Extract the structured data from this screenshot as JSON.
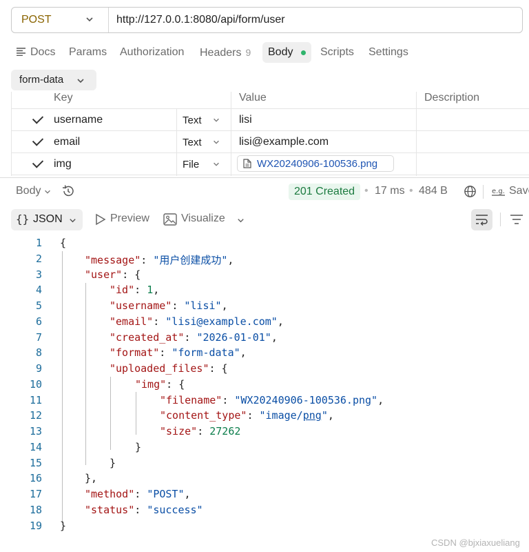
{
  "request": {
    "method": "POST",
    "url": "http://127.0.0.1:8080/api/form/user"
  },
  "tabs": {
    "docs": "Docs",
    "params": "Params",
    "authorization": "Authorization",
    "headers": "Headers",
    "headers_count": "9",
    "body": "Body",
    "scripts": "Scripts",
    "settings": "Settings"
  },
  "body_type": "form-data",
  "params_table": {
    "headers": [
      "Key",
      "Value",
      "Description"
    ],
    "rows": [
      {
        "key": "username",
        "type": "Text",
        "value": "lisi",
        "checked": true
      },
      {
        "key": "email",
        "type": "Text",
        "value": "lisi@example.com",
        "checked": true
      },
      {
        "key": "img",
        "type": "File",
        "value": "WX20240906-100536.png",
        "checked": true
      }
    ]
  },
  "response": {
    "body_label": "Body",
    "status": "201 Created",
    "time": "17 ms",
    "size": "484 B",
    "save_label": "Save"
  },
  "view": {
    "json_label": "JSON",
    "preview_label": "Preview",
    "visualize_label": "Visualize"
  },
  "code_lines": {
    "numbers": [
      "1",
      "2",
      "3",
      "4",
      "5",
      "6",
      "7",
      "8",
      "9",
      "10",
      "11",
      "12",
      "13",
      "14",
      "15",
      "16",
      "17",
      "18",
      "19"
    ],
    "message_key": "\"message\"",
    "message_val": "\"用户创建成功\"",
    "user_key": "\"user\"",
    "id_key": "\"id\"",
    "id_val": "1",
    "username_key": "\"username\"",
    "username_val": "\"lisi\"",
    "email_key": "\"email\"",
    "email_val": "\"lisi@example.com\"",
    "created_key": "\"created_at\"",
    "created_val": "\"2026-01-01\"",
    "format_key": "\"format\"",
    "format_val": "\"form-data\"",
    "uploaded_key": "\"uploaded_files\"",
    "img_key": "\"img\"",
    "filename_key": "\"filename\"",
    "filename_val": "\"WX20240906-100536.png\"",
    "ctype_key": "\"content_type\"",
    "ctype_val_a": "\"image/",
    "ctype_val_b": "png",
    "ctype_val_c": "\"",
    "size_key": "\"size\"",
    "size_val": "27262",
    "method_key": "\"method\"",
    "method_val": "\"POST\"",
    "status_key": "\"status\"",
    "status_val": "\"success\""
  },
  "watermark": "CSDN @bjxiaxueliang",
  "colors": {
    "method": "#8a6400",
    "status_green": "#1b7a3f",
    "json_key": "#a31515",
    "json_string": "#0a4ea5",
    "json_number": "#0b7d4b"
  }
}
